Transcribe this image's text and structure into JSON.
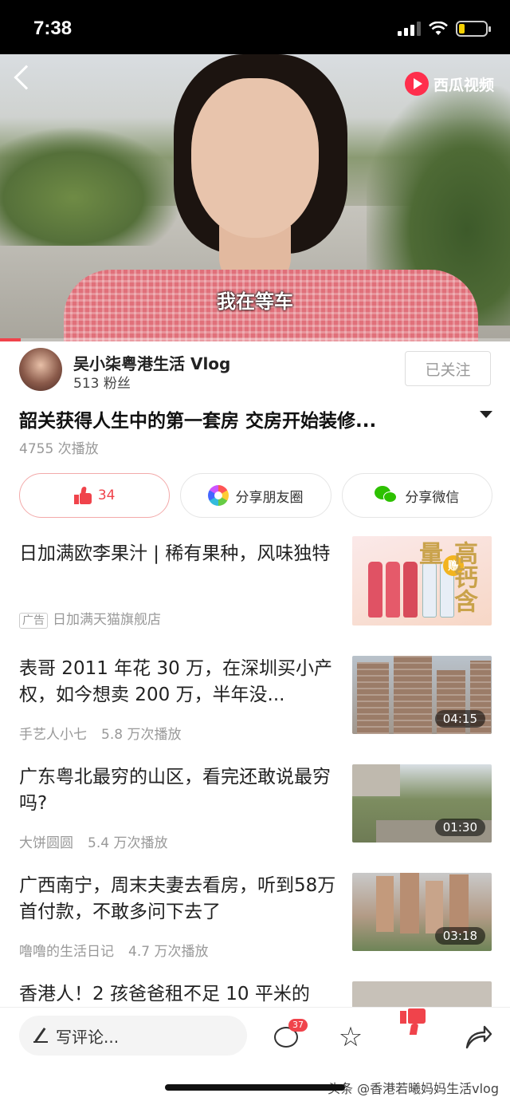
{
  "status_bar": {
    "time": "7:38"
  },
  "video": {
    "logo_text": "西瓜视频",
    "subtitle": "我在等车",
    "progress_fraction": 0.04
  },
  "author": {
    "name": "吴小柒粤港生活 Vlog",
    "fans": "513 粉丝",
    "follow_label": "已关注"
  },
  "video_info": {
    "title": "韶关获得人生中的第一套房 交房开始装修...",
    "play_count": "4755 次播放"
  },
  "actions": {
    "like_count": "34",
    "share_moments": "分享朋友圈",
    "share_wechat": "分享微信"
  },
  "feed": [
    {
      "title": "日加满欧李果汁 | 稀有果种，风味独特",
      "ad_tag": "广告",
      "source": "日加满天猫旗舰店",
      "views": "",
      "duration": ""
    },
    {
      "title": "表哥 2011 年花 30 万，在深圳买小产权，如今想卖 200 万，半年没...",
      "ad_tag": "",
      "source": "手艺人小七",
      "views": "5.8 万次播放",
      "duration": "04:15"
    },
    {
      "title": "广东粤北最穷的山区，看完还敢说最穷吗?",
      "ad_tag": "",
      "source": "大饼圆圆",
      "views": "5.4 万次播放",
      "duration": "01:30"
    },
    {
      "title": "广西南宁，周末夫妻去看房，听到58万首付款，不敢多问下去了",
      "ad_tag": "",
      "source": "噜噜的生活日记",
      "views": "4.7 万次播放",
      "duration": "03:18"
    },
    {
      "title": "香港人！2 孩爸爸租不足 10 平米的",
      "ad_tag": "",
      "source": "",
      "views": "",
      "duration": ""
    }
  ],
  "ad_thumb_text": {
    "big": "高钙含量",
    "small": "赠"
  },
  "bottom_bar": {
    "comment_placeholder": "写评论...",
    "comment_count": "37",
    "watermark": "头条 @香港若曦妈妈生活vlog"
  },
  "colors": {
    "accent": "#f0434b",
    "wechat_green": "#2dc100"
  },
  "icons": [
    "back-chevron-icon",
    "xigua-logo-icon",
    "thumbs-up-icon",
    "moments-icon",
    "wechat-icon",
    "pen-icon",
    "comment-icon",
    "star-icon",
    "share-arrow-icon"
  ]
}
